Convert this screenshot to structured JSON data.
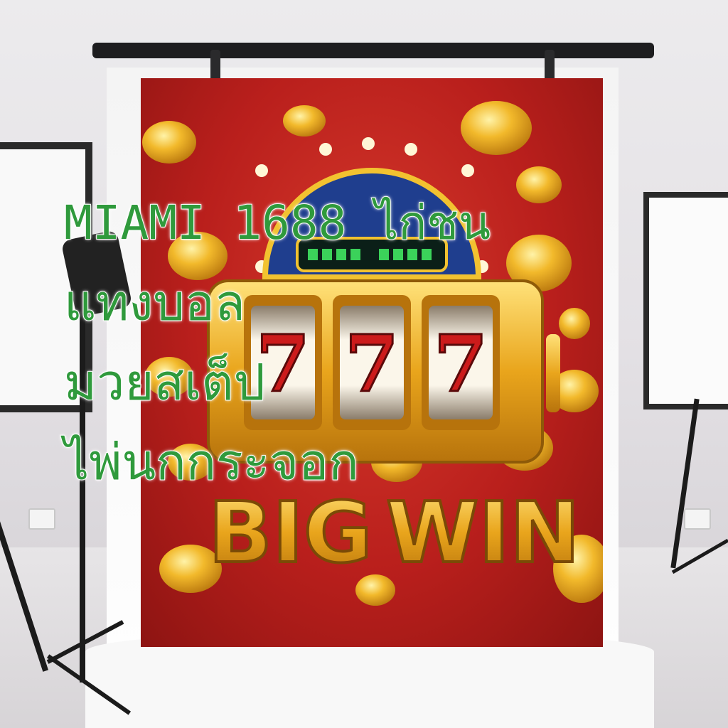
{
  "overlay": {
    "lines": [
      "MIAMI 1688 ไก่ชน",
      "แทงบอล",
      "มวยสเต็ป",
      "ไพ่นกกระจอก"
    ]
  },
  "colors": {
    "text": "#2f9a3c",
    "text_outline": "#ffffff",
    "backdrop_red": "#b91f1c",
    "gold": "#f2b92b"
  },
  "icons": [
    "studio-light-icon",
    "slot-machine-icon",
    "gold-coin-icon"
  ]
}
